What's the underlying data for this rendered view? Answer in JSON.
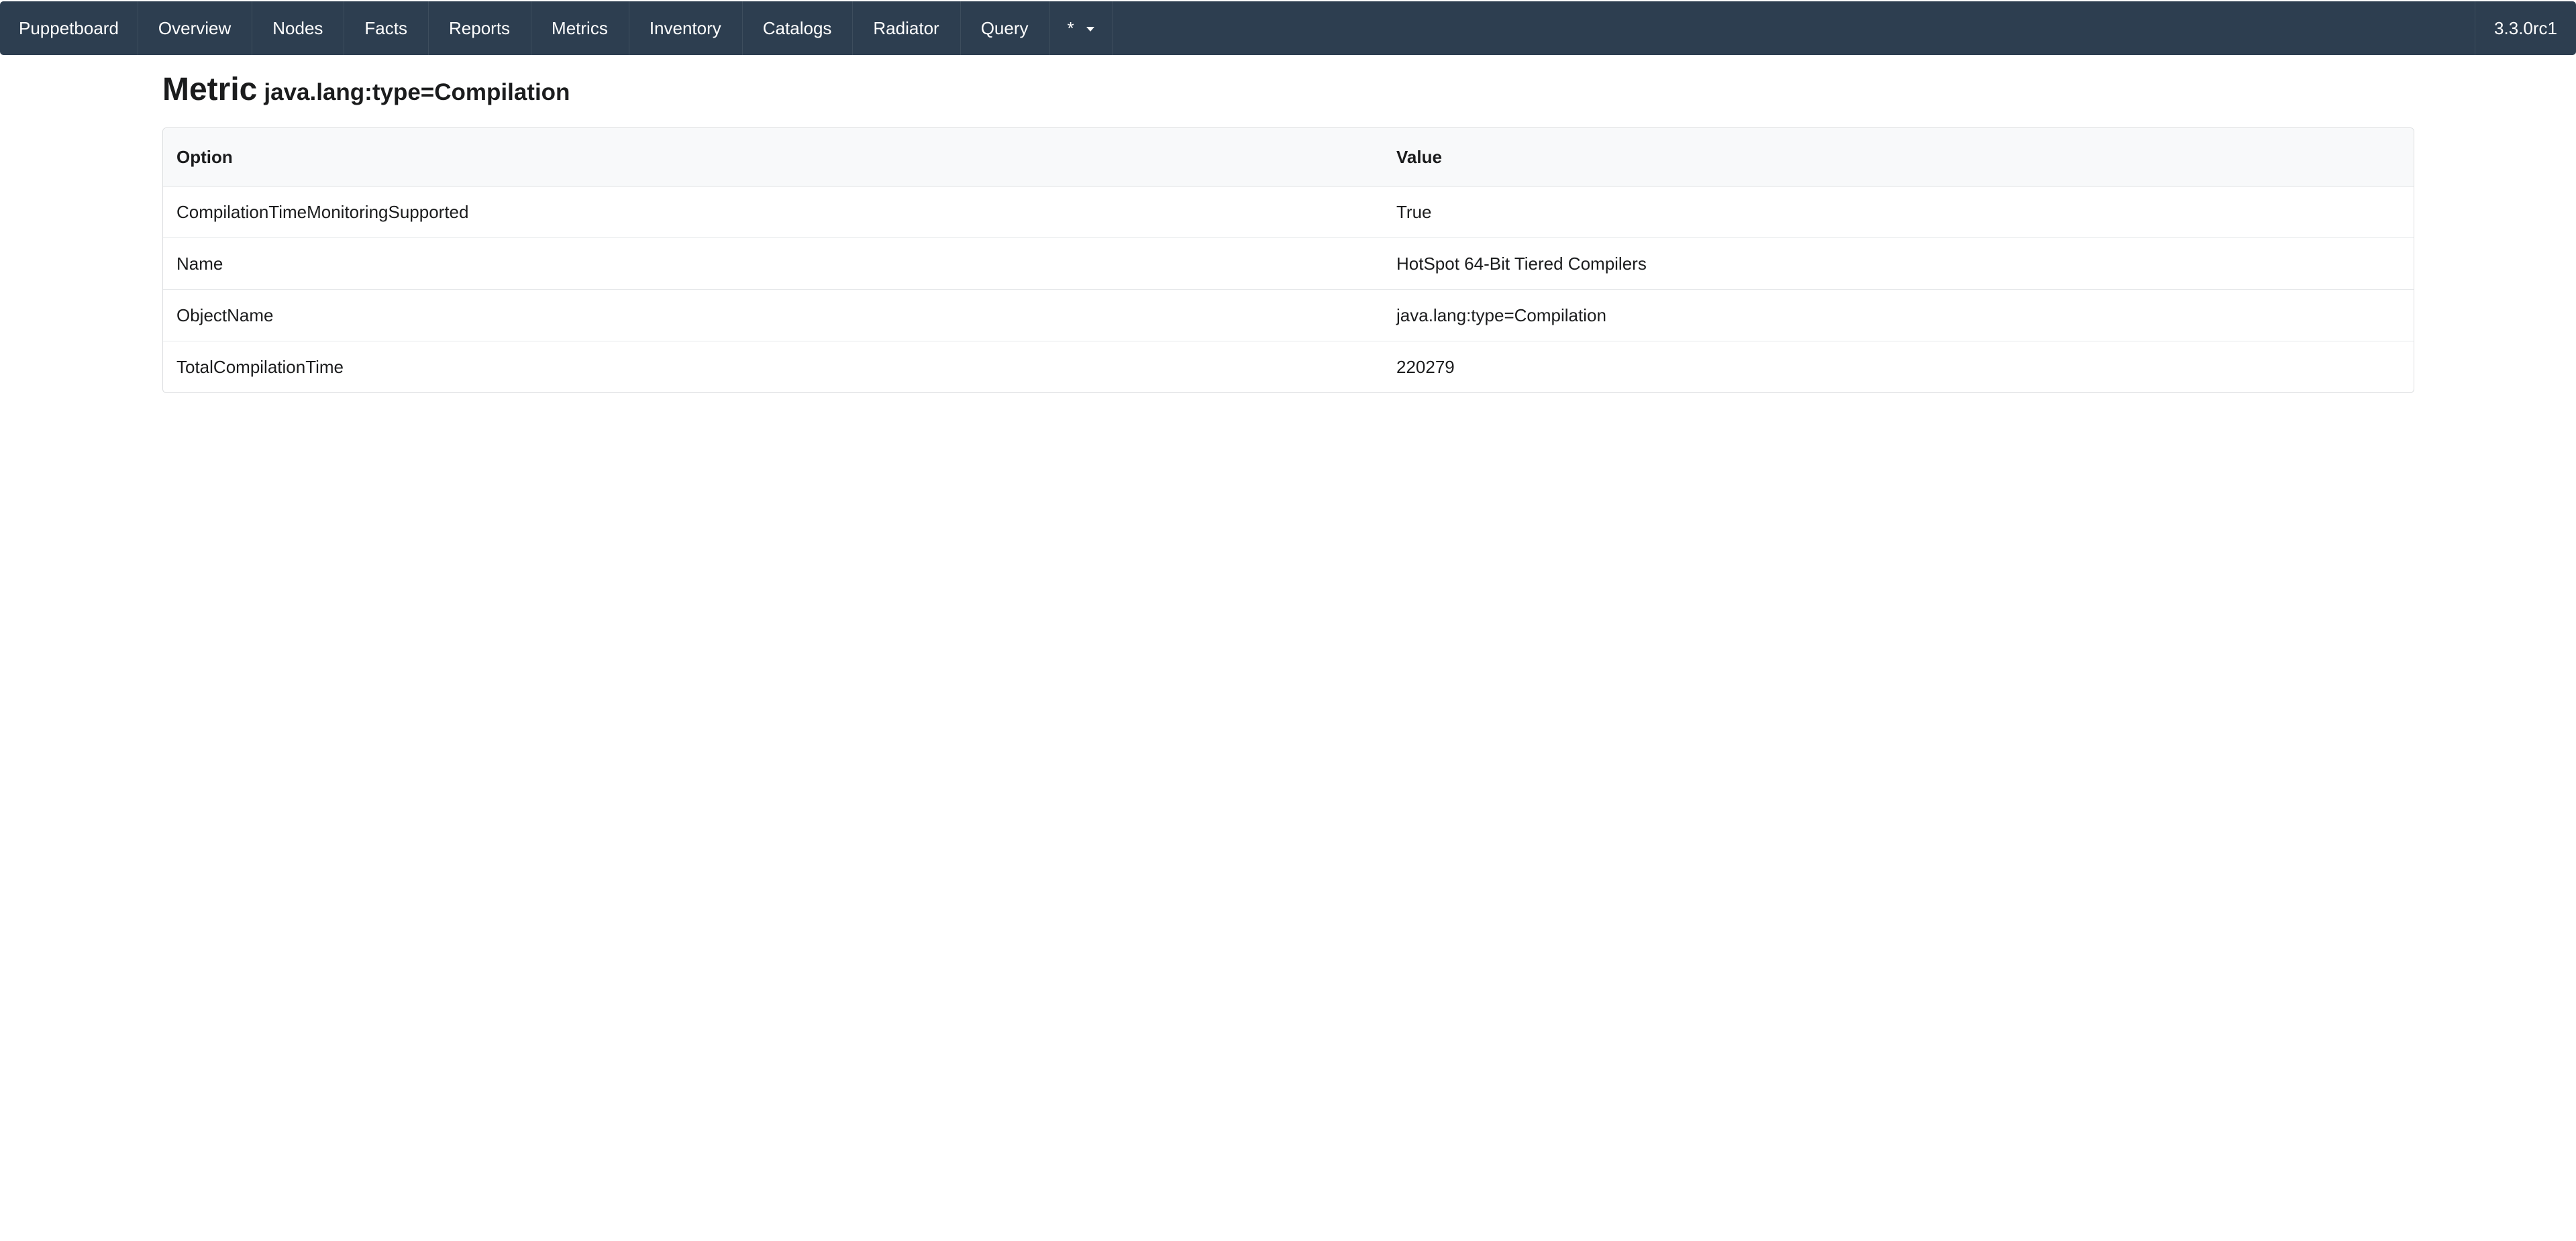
{
  "nav": {
    "brand": "Puppetboard",
    "items": [
      {
        "label": "Overview"
      },
      {
        "label": "Nodes"
      },
      {
        "label": "Facts"
      },
      {
        "label": "Reports"
      },
      {
        "label": "Metrics"
      },
      {
        "label": "Inventory"
      },
      {
        "label": "Catalogs"
      },
      {
        "label": "Radiator"
      },
      {
        "label": "Query"
      }
    ],
    "dropdown_label": "*",
    "version": "3.3.0rc1"
  },
  "page": {
    "title": "Metric",
    "subtitle": "java.lang:type=Compilation"
  },
  "table": {
    "headers": {
      "option": "Option",
      "value": "Value"
    },
    "rows": [
      {
        "option": "CompilationTimeMonitoringSupported",
        "value": "True"
      },
      {
        "option": "Name",
        "value": "HotSpot 64-Bit Tiered Compilers"
      },
      {
        "option": "ObjectName",
        "value": "java.lang:type=Compilation"
      },
      {
        "option": "TotalCompilationTime",
        "value": "220279"
      }
    ]
  },
  "colors": {
    "navbar_bg": "#2d3e50",
    "navbar_text": "#ffffff",
    "table_header_bg": "#f8f9fa",
    "border": "#dcdee0"
  }
}
